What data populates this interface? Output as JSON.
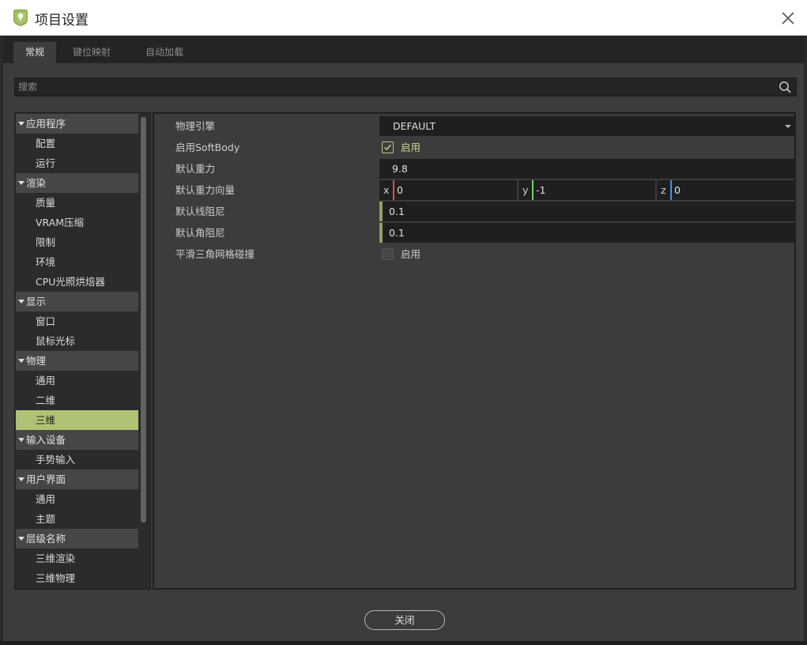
{
  "window": {
    "title": "项目设置"
  },
  "tabs": [
    {
      "label": "常规",
      "active": true
    },
    {
      "label": "键位映射",
      "active": false
    },
    {
      "label": "自动加载",
      "active": false
    }
  ],
  "search": {
    "placeholder": "搜索"
  },
  "tree": [
    {
      "type": "section",
      "label": "应用程序"
    },
    {
      "type": "item",
      "label": "配置"
    },
    {
      "type": "item",
      "label": "运行"
    },
    {
      "type": "section",
      "label": "渲染"
    },
    {
      "type": "item",
      "label": "质量"
    },
    {
      "type": "item",
      "label": "VRAM压缩"
    },
    {
      "type": "item",
      "label": "限制"
    },
    {
      "type": "item",
      "label": "环境"
    },
    {
      "type": "item",
      "label": "CPU光照烘焙器"
    },
    {
      "type": "section",
      "label": "显示"
    },
    {
      "type": "item",
      "label": "窗口"
    },
    {
      "type": "item",
      "label": "鼠标光标"
    },
    {
      "type": "section",
      "label": "物理"
    },
    {
      "type": "item",
      "label": "通用"
    },
    {
      "type": "item",
      "label": "二维"
    },
    {
      "type": "item",
      "label": "三维",
      "selected": true
    },
    {
      "type": "section",
      "label": "输入设备"
    },
    {
      "type": "item",
      "label": "手势输入"
    },
    {
      "type": "section",
      "label": "用户界面"
    },
    {
      "type": "item",
      "label": "通用"
    },
    {
      "type": "item",
      "label": "主题"
    },
    {
      "type": "section",
      "label": "层级名称"
    },
    {
      "type": "item",
      "label": "三维渲染"
    },
    {
      "type": "item",
      "label": "三维物理"
    }
  ],
  "properties": {
    "physics_engine": {
      "label": "物理引擎",
      "value": "DEFAULT"
    },
    "enable_softbody": {
      "label": "启用SoftBody",
      "checked": true,
      "check_label": "启用"
    },
    "default_gravity": {
      "label": "默认重力",
      "value": "9.8"
    },
    "default_gravity_vector": {
      "label": "默认重力向量",
      "x_axis": "x",
      "x": "0",
      "y_axis": "y",
      "y": "-1",
      "z_axis": "z",
      "z": "0"
    },
    "default_linear_damp": {
      "label": "默认线阻尼",
      "value": "0.1"
    },
    "default_angular_damp": {
      "label": "默认角阻尼",
      "value": "0.1"
    },
    "smooth_trimesh_collision": {
      "label": "平滑三角网格碰撞",
      "checked": false,
      "check_label": "启用"
    }
  },
  "close_button": {
    "label": "关闭"
  },
  "colors": {
    "accent": "#aec373",
    "axis_x": "#e0504a",
    "axis_y": "#6cd25e",
    "axis_z": "#4f8fe0",
    "panel_bg": "#3c3c3c",
    "field_bg": "#1f1f1f"
  },
  "icons": {
    "app": "godot-project-icon",
    "close": "close-icon",
    "search": "search-icon",
    "collapse": "triangle-down-icon",
    "check": "check-icon"
  }
}
